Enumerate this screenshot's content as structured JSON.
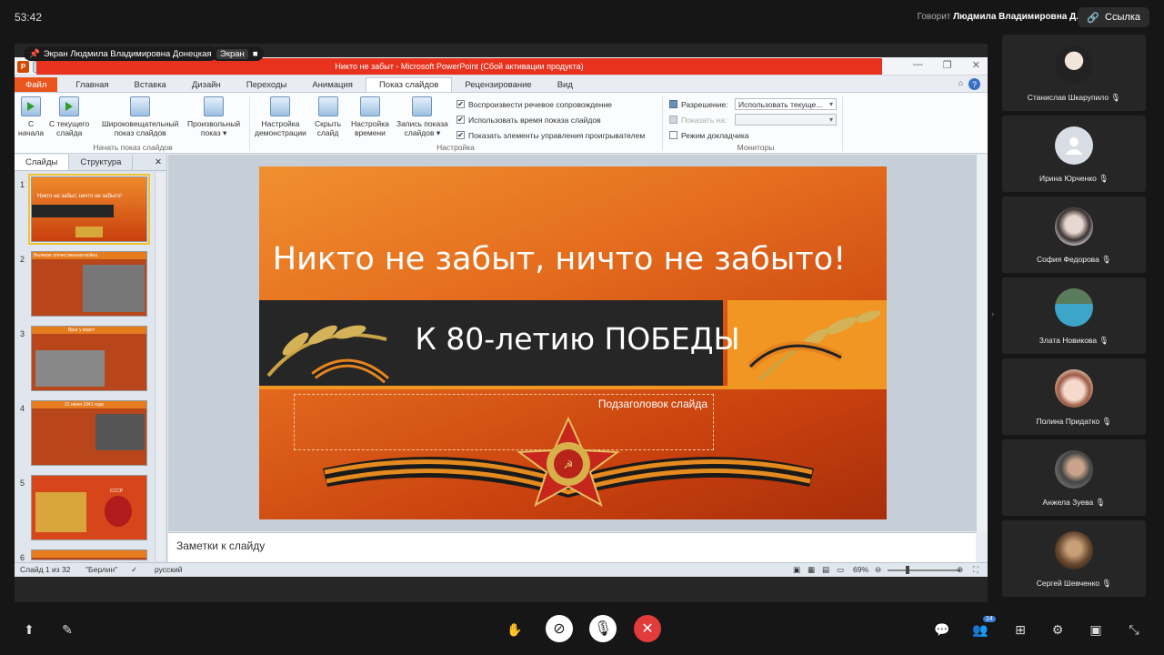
{
  "call": {
    "timer": "53:42",
    "speaking_prefix": "Говорит",
    "speaking_name": "Людмила Владимировна Д.",
    "link_label": "Ссылка",
    "screen_owner": "Экран Людмила Владимировна Донецкая",
    "screen_badge": "Экран"
  },
  "ppt": {
    "window_title": "Никто не забыт  -  Microsoft PowerPoint (Сбой активации продукта)",
    "tabs": [
      "Файл",
      "Главная",
      "Вставка",
      "Дизайн",
      "Переходы",
      "Анимация",
      "Показ слайдов",
      "Рецензирование",
      "Вид"
    ],
    "ribbon": {
      "start_group": [
        "С\nначала",
        "С текущего\nслайда",
        "Широковещательный\nпоказ слайдов",
        "Произвольный\nпоказ ▾"
      ],
      "start_group_label": "Начать показ слайдов",
      "setup_buttons": [
        "Настройка\nдемонстрации",
        "Скрыть\nслайд",
        "Настройка\nвремени",
        "Запись показа\nслайдов ▾"
      ],
      "setup_checks": [
        "Воспроизвести речевое сопровождение",
        "Использовать время показа слайдов",
        "Показать элементы управления проигрывателем"
      ],
      "setup_group_label": "Настройка",
      "resolution_label": "Разрешение:",
      "resolution_value": "Использовать текуще...",
      "show_on_label": "Показать на:",
      "presenter_view": "Режим докладчика",
      "monitors_group_label": "Мониторы"
    },
    "panel_tabs": [
      "Слайды",
      "Структура"
    ],
    "thumbs": [
      {
        "num": "1",
        "text": "Никто не забыт, ничто не забыто!"
      },
      {
        "num": "2",
        "text": "Великая отечественная война"
      },
      {
        "num": "3",
        "text": "Враг у ворот"
      },
      {
        "num": "4",
        "text": "22 июня 1941 года"
      },
      {
        "num": "5",
        "text": "СССР"
      },
      {
        "num": "6",
        "text": ""
      }
    ],
    "slide": {
      "title": "Никто не забыт, ничто не забыто!",
      "subtitle": "К 80-летию ПОБЕДЫ",
      "placeholder": "Подзаголовок  слайда"
    },
    "notes_placeholder": "Заметки к слайду",
    "status": {
      "slide_info": "Слайд 1 из 32",
      "theme": "\"Берлин\"",
      "language": "русский",
      "zoom": "69%"
    }
  },
  "participants": [
    {
      "name": "Станислав Шкарупило",
      "avatar": "photo"
    },
    {
      "name": "Ирина Юрченко",
      "avatar": "default-person-icon"
    },
    {
      "name": "София Федорова",
      "avatar": "photo"
    },
    {
      "name": "Злата Новикова",
      "avatar": "photo"
    },
    {
      "name": "Полина Придатко",
      "avatar": "photo"
    },
    {
      "name": "Анжела Зуева",
      "avatar": "photo"
    },
    {
      "name": "Сергей Шевченко",
      "avatar": "photo"
    }
  ],
  "controls": {
    "participants_count": "14"
  },
  "colors": {
    "ppt_accent": "#e9561d",
    "title_bar_red": "#e8321e",
    "end_call": "#e23b3b"
  }
}
